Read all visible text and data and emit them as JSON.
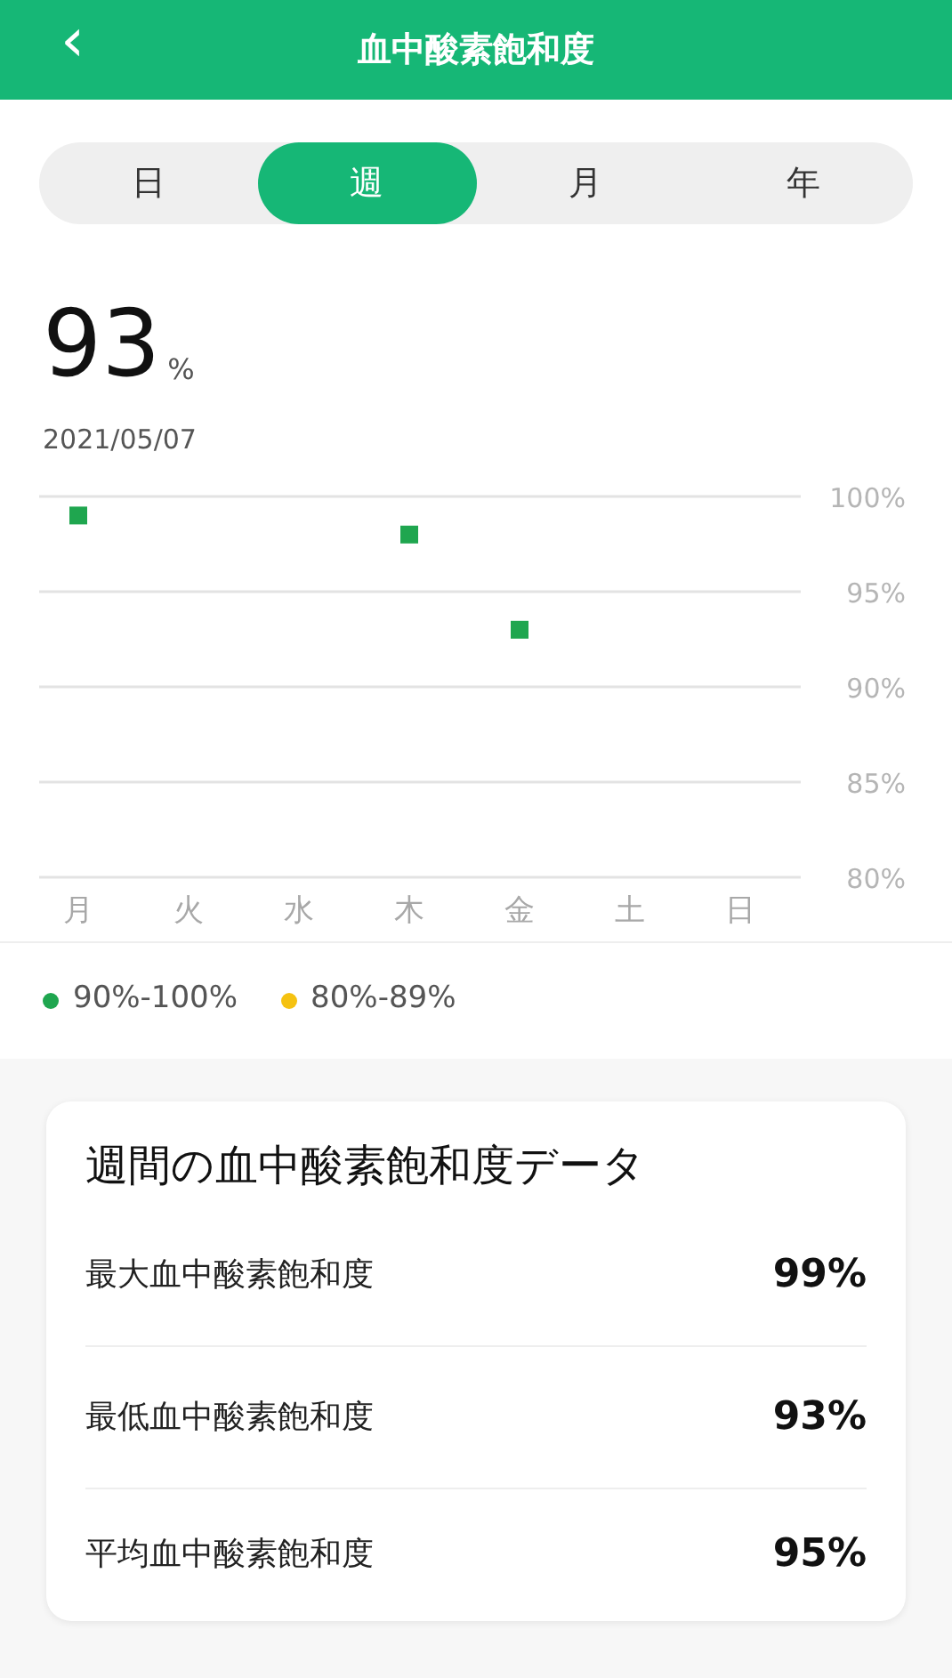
{
  "header": {
    "back_icon": "‹",
    "title": "血中酸素飽和度"
  },
  "tabs": [
    {
      "label": "日",
      "selected": false
    },
    {
      "label": "週",
      "selected": true
    },
    {
      "label": "月",
      "selected": false
    },
    {
      "label": "年",
      "selected": false
    }
  ],
  "reading": {
    "value": "93",
    "unit": "%"
  },
  "date": "2021/05/07",
  "chart_data": {
    "type": "scatter",
    "categories": [
      "月",
      "火",
      "水",
      "木",
      "金",
      "土",
      "日"
    ],
    "series": [
      {
        "color": "#1fa64f",
        "values": [
          99,
          null,
          null,
          98,
          93,
          null,
          null
        ]
      }
    ],
    "grid": true,
    "ylim": [
      80,
      100
    ],
    "yticks": [
      {
        "value": 80,
        "label": "80%"
      },
      {
        "value": 85,
        "label": "85%"
      },
      {
        "value": 90,
        "label": "90%"
      },
      {
        "value": 95,
        "label": "95%"
      },
      {
        "value": 100,
        "label": "100%"
      }
    ]
  },
  "legend": [
    {
      "label": "90%-100%",
      "color": "#1fa64f"
    },
    {
      "label": "80%-89%",
      "color": "#f5c211"
    }
  ],
  "summary": {
    "title": "週間の血中酸素飽和度データ",
    "rows": [
      {
        "label": "最大血中酸素飽和度",
        "value": "99%"
      },
      {
        "label": "最低血中酸素飽和度",
        "value": "93%"
      },
      {
        "label": "平均血中酸素飽和度",
        "value": "95%"
      }
    ]
  }
}
